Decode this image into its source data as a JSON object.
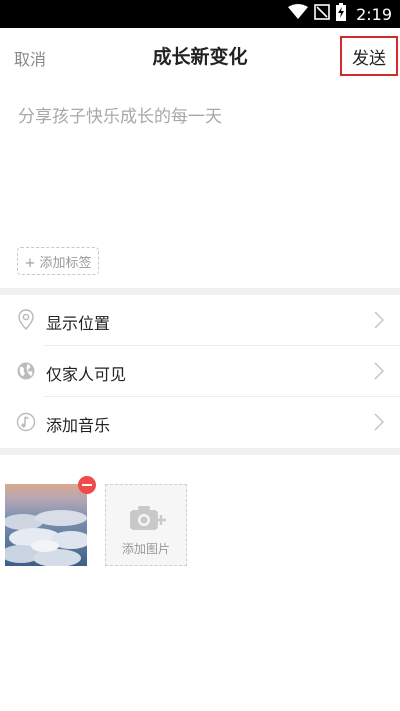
{
  "status_bar": {
    "time": "2:19",
    "icons": [
      "wifi-icon",
      "no-signal-icon",
      "battery-charging-icon"
    ]
  },
  "header": {
    "cancel_label": "取消",
    "title": "成长新变化",
    "send_label": "发送"
  },
  "composer": {
    "placeholder": "分享孩子快乐成长的每一天",
    "value": "",
    "add_tag_label": "+ 添加标签"
  },
  "options": [
    {
      "label": "显示位置",
      "icon": "location-pin-icon"
    },
    {
      "label": "仅家人可见",
      "icon": "globe-icon"
    },
    {
      "label": "添加音乐",
      "icon": "music-note-icon"
    }
  ],
  "photos": {
    "items": [
      {
        "description_icon": "clouds-photo"
      }
    ],
    "add_label": "添加图片"
  },
  "colors": {
    "accent_red": "#d22b2b",
    "remove_badge": "#f04a4a",
    "placeholder_gray": "#a8a8a8",
    "divider": "#f0f0f2"
  }
}
